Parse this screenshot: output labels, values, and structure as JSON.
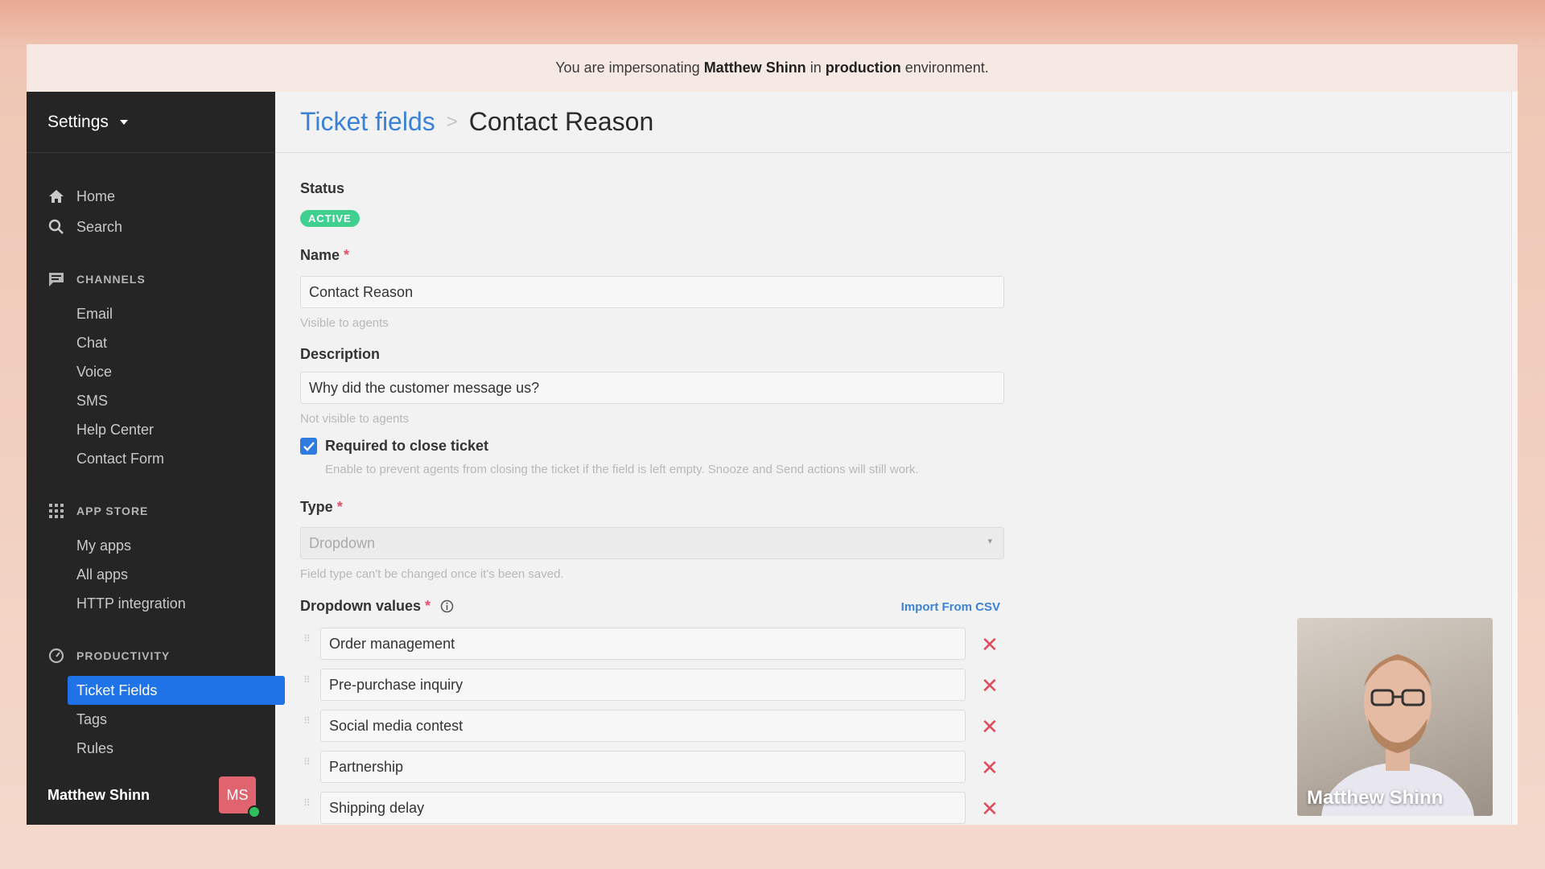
{
  "banner": {
    "prefix": "You are impersonating",
    "user": "Matthew Shinn",
    "middle": "in",
    "env": "production",
    "suffix": "environment."
  },
  "sidebar": {
    "title": "Settings",
    "top_items": [
      {
        "label": "Home",
        "icon": "home-icon"
      },
      {
        "label": "Search",
        "icon": "search-icon"
      }
    ],
    "sections": [
      {
        "title": "CHANNELS",
        "icon": "chat-icon",
        "items": [
          "Email",
          "Chat",
          "Voice",
          "SMS",
          "Help Center",
          "Contact Form"
        ]
      },
      {
        "title": "APP STORE",
        "icon": "grid-icon",
        "items": [
          "My apps",
          "All apps",
          "HTTP integration"
        ]
      },
      {
        "title": "PRODUCTIVITY",
        "icon": "gauge-icon",
        "items": [
          "Ticket Fields",
          "Tags",
          "Rules"
        ]
      }
    ],
    "active_item": "Ticket Fields",
    "user": {
      "name": "Matthew Shinn",
      "initials": "MS"
    }
  },
  "header": {
    "breadcrumb_link": "Ticket fields",
    "separator": ">",
    "current": "Contact Reason"
  },
  "form": {
    "status_label": "Status",
    "status_badge": "ACTIVE",
    "name_label": "Name",
    "required_mark": "*",
    "name_value": "Contact Reason",
    "name_hint": "Visible to agents",
    "description_label": "Description",
    "description_value": "Why did the customer message us?",
    "description_hint": "Not visible to agents",
    "required_checkbox_label": "Required to close ticket",
    "required_checkbox_checked": true,
    "required_checkbox_hint": "Enable to prevent agents from closing the ticket if the field is left empty. Snooze and Send actions will still work.",
    "type_label": "Type",
    "type_value": "Dropdown",
    "type_hint": "Field type can't be changed once it's been saved.",
    "dropdown_label": "Dropdown values",
    "import_link": "Import From CSV",
    "dropdown_values": [
      "Order management",
      "Pre-purchase inquiry",
      "Social media contest",
      "Partnership",
      "Shipping delay"
    ]
  },
  "video": {
    "name": "Matthew Shinn"
  },
  "colors": {
    "accent": "#1f73e6",
    "sidebar_bg": "#252525",
    "badge": "#3fcf8e",
    "remove": "#e04a5c"
  }
}
